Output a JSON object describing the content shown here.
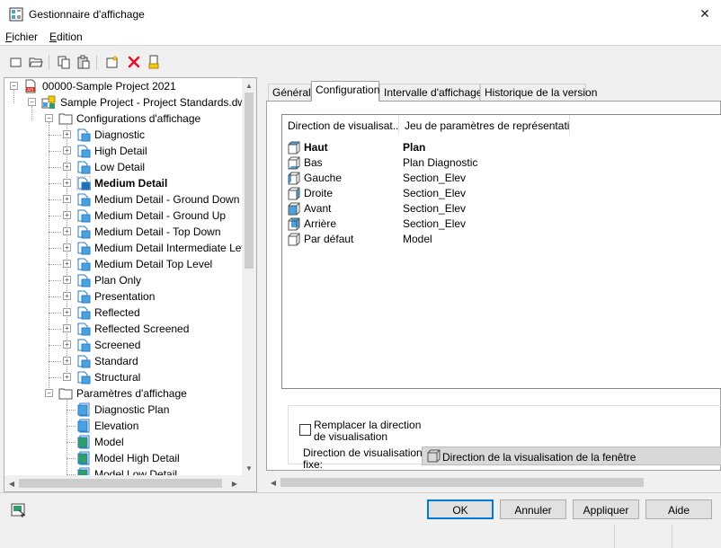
{
  "window": {
    "title": "Gestionnaire d'affichage",
    "close_glyph": "✕"
  },
  "menu": {
    "items": [
      {
        "accel": "F",
        "rest": "ichier"
      },
      {
        "accel": "E",
        "rest": "dition"
      }
    ]
  },
  "toolbar": {
    "icons": [
      "new-icon",
      "open-icon",
      "copy-icon",
      "paste-icon",
      "new-config-icon",
      "delete-icon",
      "purge-icon"
    ]
  },
  "tree": {
    "root": "00000-Sample Project 2021",
    "project": "Sample Project - Project Standards.dwg",
    "configs_folder": "Configurations d'affichage",
    "configs": [
      "Diagnostic",
      "High Detail",
      "Low Detail",
      "Medium Detail",
      "Medium Detail - Ground Down",
      "Medium Detail - Ground Up",
      "Medium Detail - Top Down",
      "Medium Detail Intermediate Level",
      "Medium Detail Top Level",
      "Plan Only",
      "Presentation",
      "Reflected",
      "Reflected Screened",
      "Screened",
      "Standard",
      "Structural"
    ],
    "selected_config": "Medium Detail",
    "params_folder": "Paramètres d'affichage",
    "params": [
      "Diagnostic Plan",
      "Elevation",
      "Model",
      "Model High Detail",
      "Model Low Detail"
    ]
  },
  "tabs": [
    {
      "label": "Général"
    },
    {
      "label": "Configuration"
    },
    {
      "label": "Intervalle d'affichage"
    },
    {
      "label": "Historique de la version"
    }
  ],
  "active_tab": "Configuration",
  "list": {
    "columns": [
      "Direction de visualisat...",
      "Jeu de paramètres de représentati..."
    ],
    "rows": [
      {
        "direction": "Haut",
        "set": "Plan",
        "bold": true
      },
      {
        "direction": "Bas",
        "set": "Plan Diagnostic"
      },
      {
        "direction": "Gauche",
        "set": "Section_Elev"
      },
      {
        "direction": "Droite",
        "set": "Section_Elev"
      },
      {
        "direction": "Avant",
        "set": "Section_Elev"
      },
      {
        "direction": "Arrière",
        "set": "Section_Elev"
      },
      {
        "direction": "Par défaut",
        "set": "Model"
      }
    ]
  },
  "override": {
    "label_line1": "Remplacer la direction",
    "label_line2": "de visualisation",
    "checked": false,
    "fixed_label_line1": "Direction de visualisation",
    "fixed_label_line2": "fixe:",
    "fixed_value": "Direction de la visualisation de la fenêtre"
  },
  "buttons": {
    "ok": "OK",
    "cancel": "Annuler",
    "apply": "Appliquer",
    "help": "Aide"
  },
  "colors": {
    "accent": "#0078d7",
    "delete": "#e81123",
    "icon_blue": "#4aa3df",
    "icon_teal": "#2e9e6a"
  }
}
